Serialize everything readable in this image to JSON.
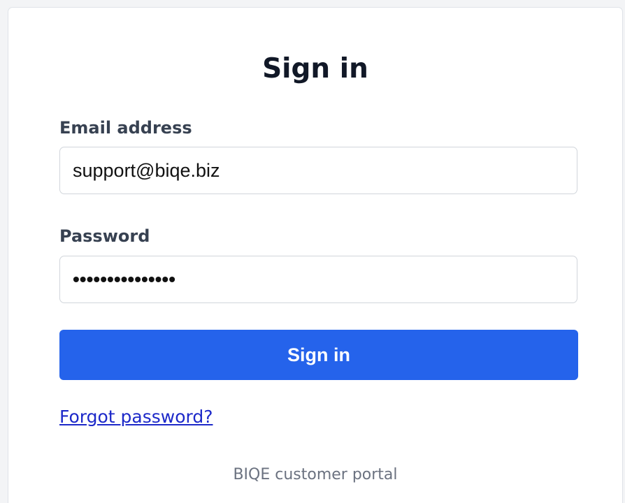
{
  "form": {
    "title": "Sign in",
    "email": {
      "label": "Email address",
      "value": "support@biqe.biz"
    },
    "password": {
      "label": "Password",
      "masked_value": "•••••••••••••••"
    },
    "submit_label": "Sign in",
    "forgot_password_label": "Forgot password?"
  },
  "footer": {
    "text": "BIQE customer portal"
  },
  "colors": {
    "accent": "#2563eb",
    "link": "#1d29c9",
    "title": "#111827",
    "label": "#374151",
    "footer": "#6b7280"
  }
}
